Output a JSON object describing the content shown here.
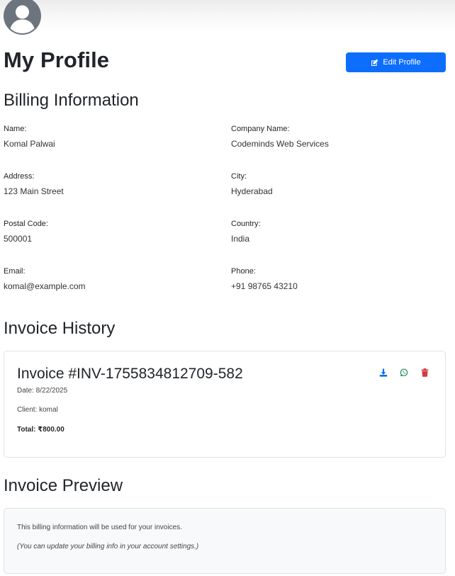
{
  "header": {
    "avatar_icon": "user-circle-icon",
    "title": "My Profile",
    "edit_button_label": "Edit Profile",
    "edit_icon": "edit-icon"
  },
  "billing": {
    "title": "Billing Information",
    "fields": {
      "name": {
        "label": "Name:",
        "value": "Komal Palwai"
      },
      "company": {
        "label": "Company Name:",
        "value": "Codeminds Web Services"
      },
      "address": {
        "label": "Address:",
        "value": "123 Main Street"
      },
      "city": {
        "label": "City:",
        "value": "Hyderabad"
      },
      "postal": {
        "label": "Postal Code:",
        "value": "500001"
      },
      "country": {
        "label": "Country:",
        "value": "India"
      },
      "email": {
        "label": "Email:",
        "value": "komal@example.com"
      },
      "phone": {
        "label": "Phone:",
        "value": "+91 98765 43210"
      }
    }
  },
  "invoices": {
    "title": "Invoice History",
    "items": [
      {
        "title": "Invoice #INV-1755834812709-582",
        "date": "Date: 8/22/2025",
        "client": "Client: komal",
        "total": "Total: ₹800.00",
        "actions": [
          "download-icon",
          "whatsapp-icon",
          "trash-icon"
        ]
      }
    ]
  },
  "preview": {
    "title": "Invoice Preview",
    "line1": "This billing information will be used for your invoices.",
    "line2": "(You can update your billing info in your account settings.)"
  },
  "colors": {
    "primary": "#0d6efd",
    "success": "#198754",
    "danger": "#dc3545",
    "avatar": "#6c757d"
  }
}
